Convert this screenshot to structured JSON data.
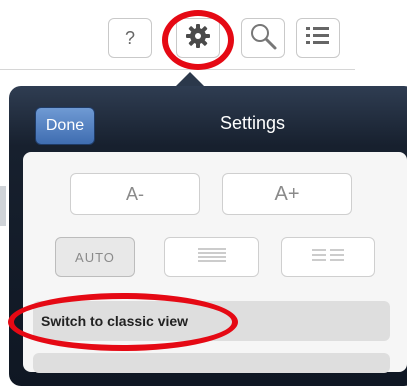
{
  "toolbar": {
    "help_label": "?",
    "icons": [
      "help-icon",
      "gear-icon",
      "search-icon",
      "list-icon"
    ]
  },
  "popover": {
    "done_label": "Done",
    "title": "Settings",
    "font_decrease_label": "A-",
    "font_increase_label": "A+",
    "auto_label": "AUTO",
    "switch_label": "Switch to classic view"
  },
  "colors": {
    "highlight_red": "#e50914",
    "popover_dark": "#17202e",
    "done_blue": "#4f7fc3"
  }
}
